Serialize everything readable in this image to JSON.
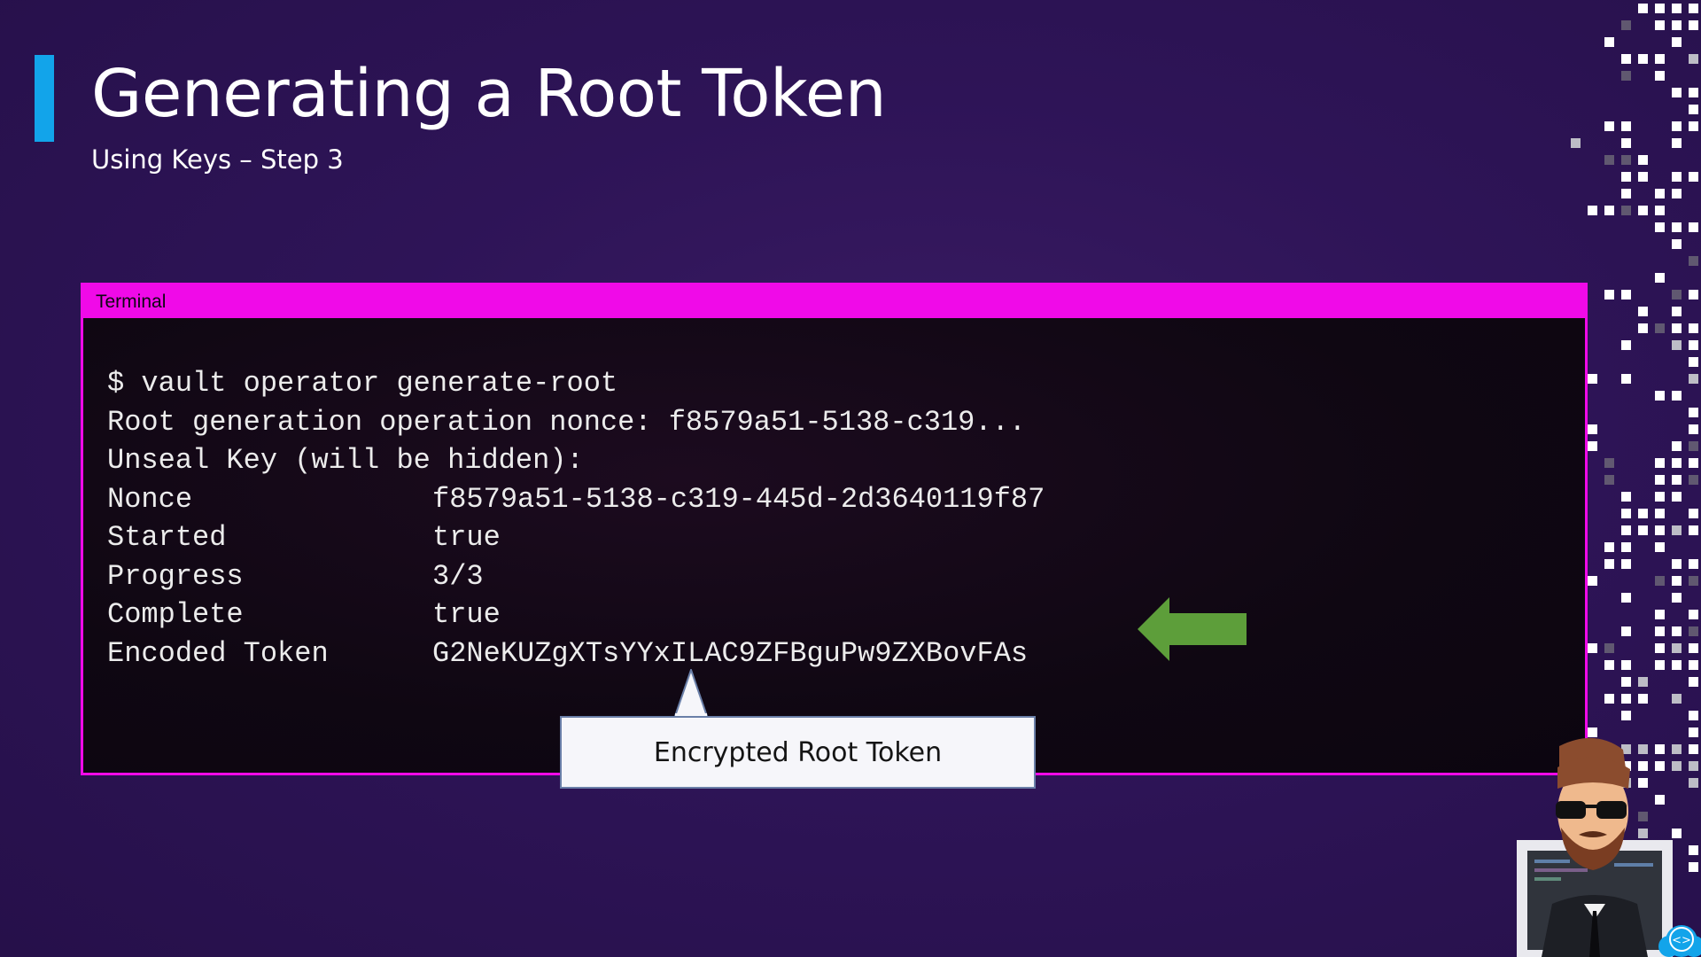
{
  "slide": {
    "title": "Generating a Root Token",
    "subtitle": "Using Keys – Step 3",
    "accent_color": "#12a4ea",
    "background_color": "#2e1457"
  },
  "terminal": {
    "header_label": "Terminal",
    "border_color": "#f00ae8",
    "command_line": "$ vault operator generate-root",
    "lines": [
      "Root generation operation nonce: f8579a51-5138-c319...",
      "Unseal Key (will be hidden):"
    ],
    "rows": [
      {
        "key": "Nonce",
        "value": "f8579a51-5138-c319-445d-2d3640119f87"
      },
      {
        "key": "Started",
        "value": "true"
      },
      {
        "key": "Progress",
        "value": "3/3"
      },
      {
        "key": "Complete",
        "value": "true"
      },
      {
        "key": "Encoded Token",
        "value": "G2NeKUZgXTsYYxILAC9ZFBguPw9ZXBovFAs"
      }
    ]
  },
  "annotations": {
    "arrow_icon": "left-arrow-icon",
    "arrow_color": "#5d9e3a",
    "callout_text": "Encrypted Root Token"
  },
  "decor": {
    "mascot_icon": "presenter-avatar-icon",
    "logo_icon": "code-cloud-icon",
    "pattern_icon": "pixel-pattern"
  }
}
